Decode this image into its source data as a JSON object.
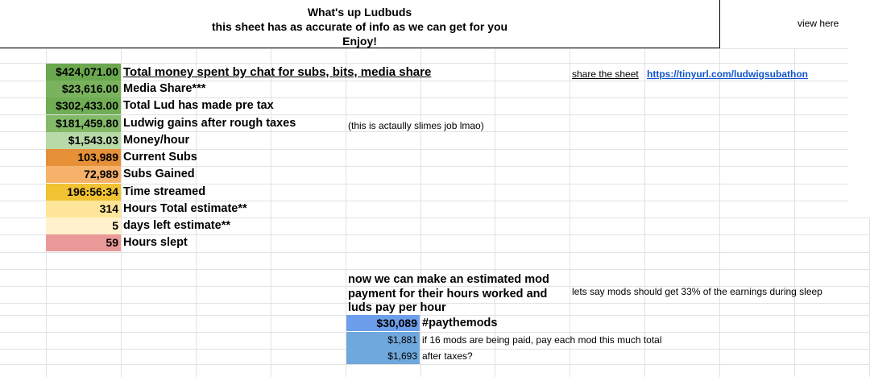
{
  "header": {
    "line1": "What's up Ludbuds",
    "line2": "this sheet has as accurate of info as we can get for you",
    "line3": "Enjoy!",
    "view_here": "view here"
  },
  "stats": [
    {
      "value": "$424,071.00",
      "label": "Total money spent by chat for subs, bits, media share",
      "color": "#6aa84f"
    },
    {
      "value": "$23,616.00",
      "label": "Media Share***",
      "color": "#7ab35d"
    },
    {
      "value": "$302,433.00",
      "label": "Total Lud has made pre tax",
      "color": "#71ad55"
    },
    {
      "value": "$181,459.80",
      "label": "Ludwig gains after rough taxes",
      "color": "#82ba68"
    },
    {
      "value": "$1,543.03",
      "label": "Money/hour",
      "color": "#b8d9a8"
    },
    {
      "value": "103,989",
      "label": "Current Subs",
      "color": "#e69138"
    },
    {
      "value": "72,989",
      "label": "Subs Gained",
      "color": "#f6b26b"
    },
    {
      "value": "196:56:34",
      "label": "Time streamed",
      "color": "#f1c232"
    },
    {
      "value": "314",
      "label": "Hours Total estimate**",
      "color": "#ffe599"
    },
    {
      "value": "5",
      "label": "days left estimate**",
      "color": "#fff2cc"
    },
    {
      "value": "59",
      "label": "Hours slept",
      "color": "#ea9999"
    }
  ],
  "share": {
    "label": "share the sheet",
    "url": "https://tinyurl.com/ludwigsubathon"
  },
  "note_slimes": "(this is actaully slimes job lmao)",
  "mod": {
    "line1": "now we can make an estimated mod",
    "line2": "payment for their hours worked and",
    "line3": "luds pay per hour",
    "note": "lets say mods should get 33% of the earnings during sleep",
    "rows": [
      {
        "value": "$30,089",
        "label": "#paythemods",
        "color": "#6d9eeb"
      },
      {
        "value": "$1,881",
        "label": "if 16 mods are being paid, pay each mod this much total",
        "color": "#6fa8dc"
      },
      {
        "value": "$1,693",
        "label": "after taxes?",
        "color": "#6fa8dc"
      }
    ]
  }
}
